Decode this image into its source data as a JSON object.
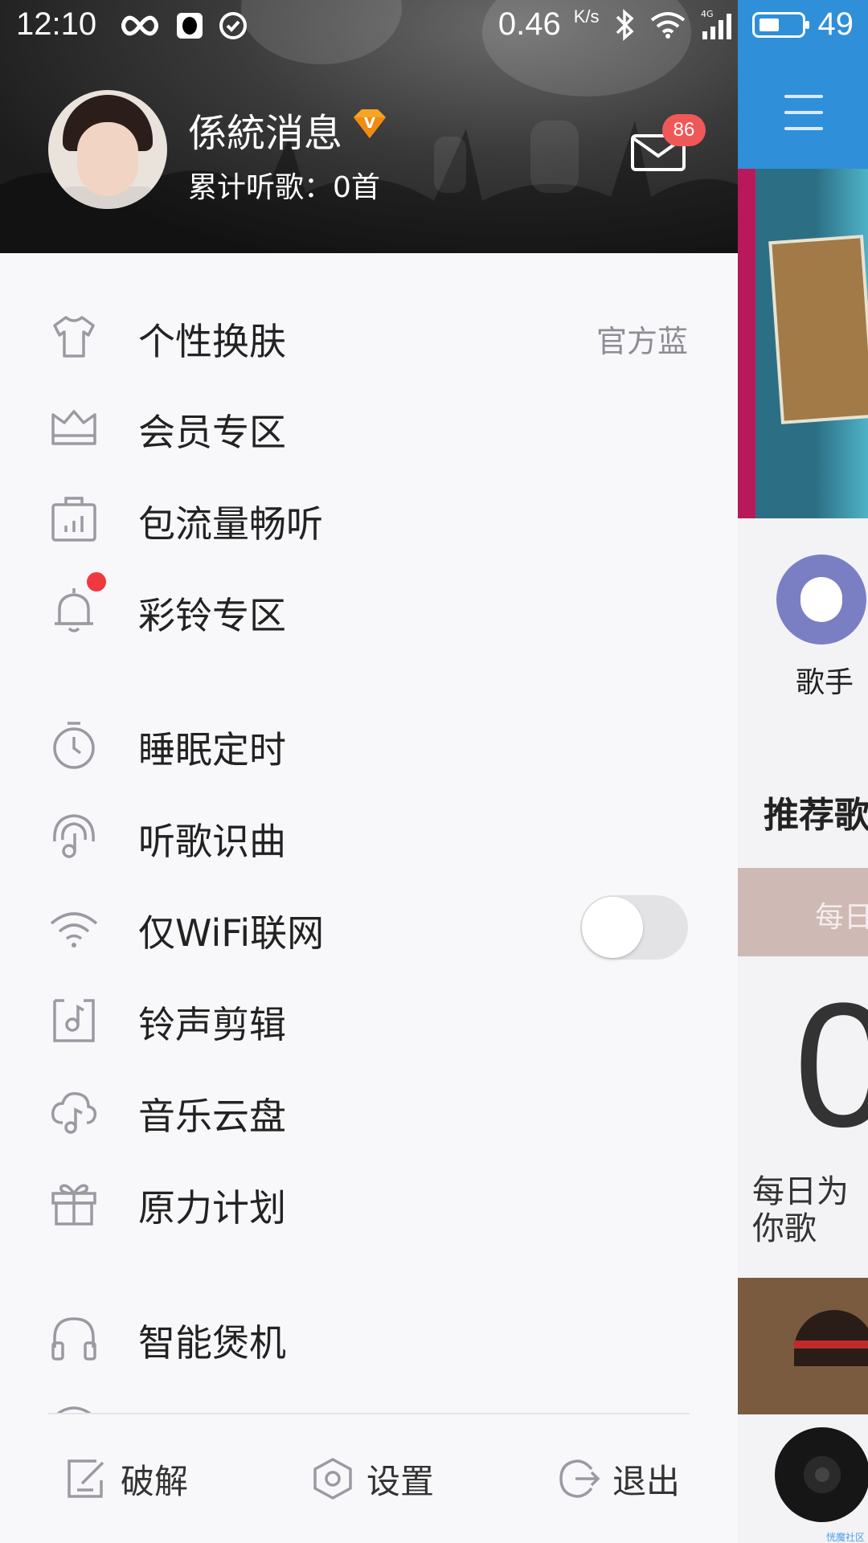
{
  "status_bar": {
    "time": "12:10",
    "speed": "0.46",
    "speed_unit": "K/s",
    "network": "4G",
    "battery": "49",
    "battery_level": 0.49
  },
  "drawer": {
    "user": {
      "name": "係統消息",
      "listen_count": "累计听歌：0首",
      "message_badge": "86"
    },
    "menu_groups": [
      [
        {
          "icon": "tshirt-icon",
          "label": "个性换肤",
          "value": "官方蓝"
        },
        {
          "icon": "crown-icon",
          "label": "会员专区"
        },
        {
          "icon": "data-bag-icon",
          "label": "包流量畅听"
        },
        {
          "icon": "bell-icon",
          "label": "彩铃专区",
          "dot": true
        }
      ],
      [
        {
          "icon": "timer-icon",
          "label": "睡眠定时"
        },
        {
          "icon": "recognize-music-icon",
          "label": "听歌识曲"
        },
        {
          "icon": "wifi-icon",
          "label": "仅WiFi联网",
          "toggle": false
        },
        {
          "icon": "ringtone-cut-icon",
          "label": "铃声剪辑"
        },
        {
          "icon": "cloud-music-icon",
          "label": "音乐云盘"
        },
        {
          "icon": "gift-icon",
          "label": "原力计划"
        }
      ],
      [
        {
          "icon": "headphones-icon",
          "label": "智能煲机"
        }
      ]
    ],
    "footer": {
      "crack": "破解",
      "settings": "设置",
      "logout": "退出"
    }
  },
  "background_app": {
    "singer_label": "歌手",
    "recommend_title": "推荐歌",
    "daily_bar": "每日",
    "big_number": "0",
    "caption": "每日为你歌",
    "watermark": "恍魔社区"
  },
  "colors": {
    "accent_blue": "#2f8fd9",
    "badge_red": "#f05858",
    "icon_gray": "#9a9aa3",
    "drawer_bg": "#f8f8fa"
  }
}
